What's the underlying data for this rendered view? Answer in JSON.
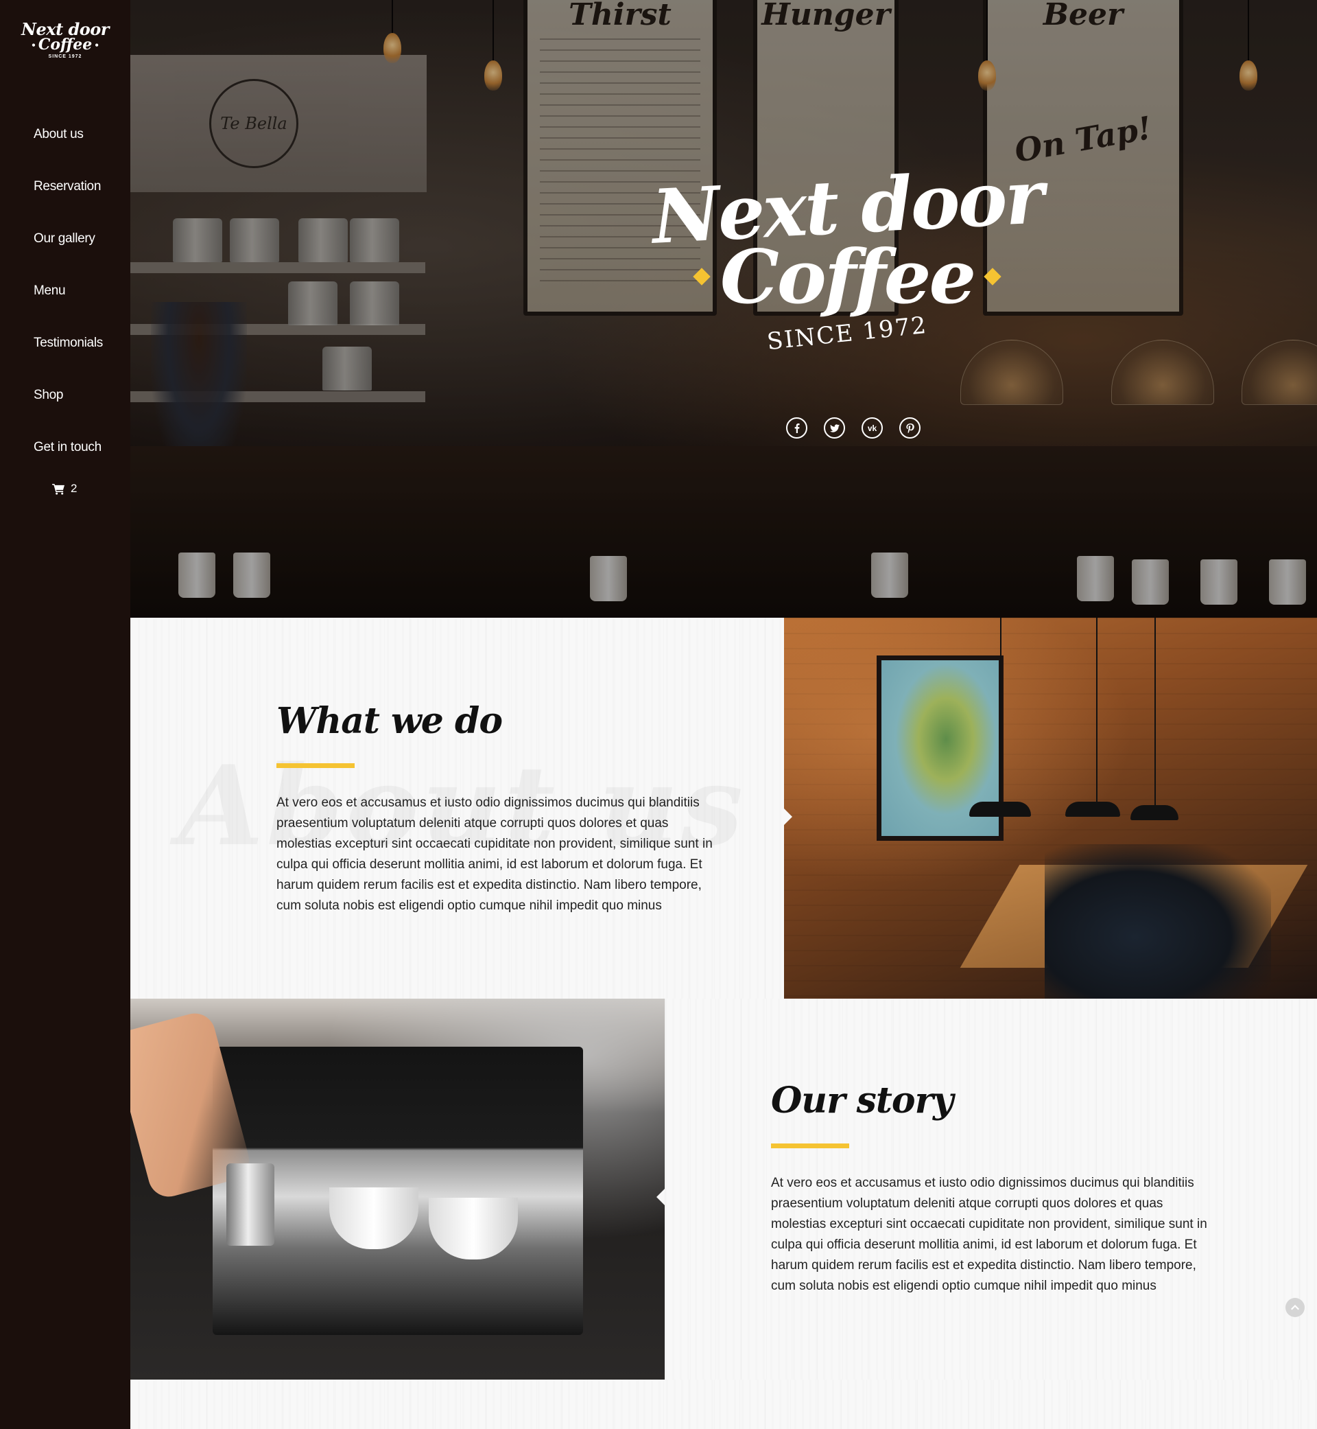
{
  "brand": {
    "logo_line1": "Next door",
    "logo_line2": "Coffee",
    "logo_since": "SINCE 1972"
  },
  "sidebar": {
    "items": [
      {
        "label": "About us"
      },
      {
        "label": "Reservation"
      },
      {
        "label": "Our gallery"
      },
      {
        "label": "Menu"
      },
      {
        "label": "Testimonials"
      },
      {
        "label": "Shop"
      },
      {
        "label": "Get in touch"
      }
    ],
    "cart_count": "2",
    "cart_icon": "cart-icon"
  },
  "hero": {
    "title_line1": "Next door",
    "title_line2": "Coffee",
    "since": "SINCE 1972",
    "board1_title": "Thirst",
    "board2_title": "Hunger",
    "board3_title": "Beer",
    "board3_sub": "On Tap!",
    "sign_text": "Te Bella",
    "social": [
      {
        "name": "facebook-icon"
      },
      {
        "name": "twitter-icon"
      },
      {
        "name": "vk-icon"
      },
      {
        "name": "pinterest-icon"
      }
    ]
  },
  "about": {
    "title": "What we do",
    "ghost_text": "About us",
    "text": "At vero eos et accusamus et iusto odio dignissimos ducimus qui blanditiis praesentium voluptatum deleniti atque corrupti quos dolores et quas molestias excepturi sint occaecati cupiditate non provident, similique sunt in culpa qui officia deserunt mollitia animi, id est laborum et dolorum fuga. Et harum quidem rerum facilis est et expedita distinctio. Nam libero tempore, cum soluta nobis est eligendi optio cumque nihil impedit quo minus"
  },
  "story": {
    "title": "Our story",
    "text": "At vero eos et accusamus et iusto odio dignissimos ducimus qui blanditiis praesentium voluptatum deleniti atque corrupti quos dolores et quas molestias excepturi sint occaecati cupiditate non provident, similique sunt in culpa qui officia deserunt mollitia animi, id est laborum et dolorum fuga. Et harum quidem rerum facilis est et expedita distinctio. Nam libero tempore, cum soluta nobis est eligendi optio cumque nihil impedit quo minus"
  },
  "colors": {
    "sidebar_bg": "#1b0f0c",
    "accent": "#f5c332",
    "text_dark": "#111111"
  }
}
